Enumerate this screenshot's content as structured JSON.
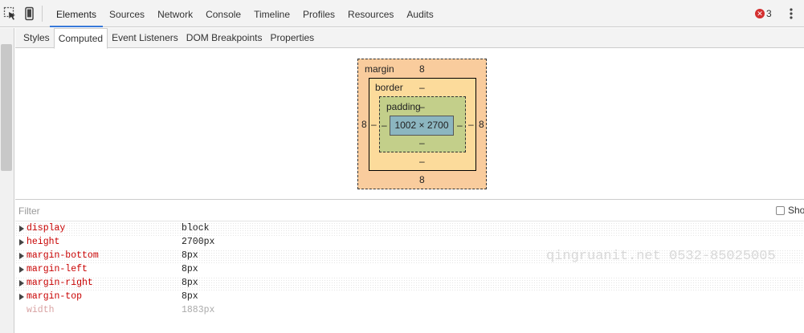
{
  "toolbar": {
    "tabs": [
      {
        "label": "Elements",
        "active": true
      },
      {
        "label": "Sources",
        "active": false
      },
      {
        "label": "Network",
        "active": false
      },
      {
        "label": "Console",
        "active": false
      },
      {
        "label": "Timeline",
        "active": false
      },
      {
        "label": "Profiles",
        "active": false
      },
      {
        "label": "Resources",
        "active": false
      },
      {
        "label": "Audits",
        "active": false
      }
    ],
    "icons": {
      "inspect": "inspect-element-icon",
      "device": "device-mode-icon",
      "error": "error-icon",
      "menu": "more-menu-icon"
    },
    "error_count": "3"
  },
  "subtabs": [
    {
      "label": "Styles",
      "active": false
    },
    {
      "label": "Computed",
      "active": true
    },
    {
      "label": "Event Listeners",
      "active": false
    },
    {
      "label": "DOM Breakpoints",
      "active": false
    },
    {
      "label": "Properties",
      "active": false
    }
  ],
  "box_model": {
    "margin": {
      "label": "margin",
      "top": "8",
      "bottom": "8",
      "left": "8",
      "right": "8"
    },
    "border": {
      "label": "border",
      "top": "–",
      "bottom": "–",
      "left": "–",
      "right": "–"
    },
    "padding": {
      "label": "padding",
      "top": "–",
      "bottom": "–",
      "left": "–",
      "right": "–"
    },
    "content": "1002 × 2700"
  },
  "filter": {
    "placeholder": "Filter",
    "value": "",
    "show_all_label": "Sho"
  },
  "properties": [
    {
      "name": "display",
      "value": "block",
      "inactive": false
    },
    {
      "name": "height",
      "value": "2700px",
      "inactive": false
    },
    {
      "name": "margin-bottom",
      "value": "8px",
      "inactive": false
    },
    {
      "name": "margin-left",
      "value": "8px",
      "inactive": false
    },
    {
      "name": "margin-right",
      "value": "8px",
      "inactive": false
    },
    {
      "name": "margin-top",
      "value": "8px",
      "inactive": false
    },
    {
      "name": "width",
      "value": "1883px",
      "inactive": true
    }
  ],
  "watermark": "qingruanit.net 0532-85025005",
  "colors": {
    "margin": "#f9cc9d",
    "border": "#fcdb9b",
    "padding": "#c3cf8a",
    "content": "#8cb6c0",
    "property_name": "#c80000",
    "active_tab_underline": "#3879d9",
    "error": "#d32f2f"
  }
}
